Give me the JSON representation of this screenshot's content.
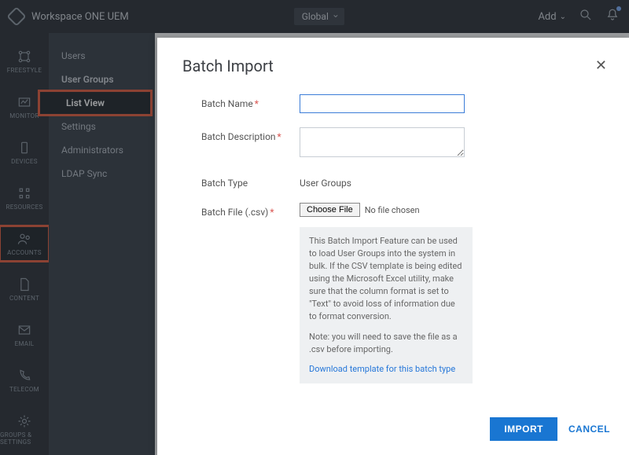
{
  "header": {
    "product": "Workspace ONE UEM",
    "org_selector": "Global",
    "add_label": "Add"
  },
  "leftrail": [
    {
      "id": "freestyle",
      "label": "FREESTYLE"
    },
    {
      "id": "monitor",
      "label": "MONITOR"
    },
    {
      "id": "devices",
      "label": "DEVICES"
    },
    {
      "id": "resources",
      "label": "RESOURCES"
    },
    {
      "id": "accounts",
      "label": "ACCOUNTS"
    },
    {
      "id": "content",
      "label": "CONTENT"
    },
    {
      "id": "email",
      "label": "EMAIL"
    },
    {
      "id": "telecom",
      "label": "TELECOM"
    },
    {
      "id": "groups",
      "label": "GROUPS & SETTINGS"
    }
  ],
  "subnav": {
    "items": [
      {
        "label": "Users"
      },
      {
        "label": "User Groups"
      },
      {
        "label": "List View"
      },
      {
        "label": "Settings"
      },
      {
        "label": "Administrators"
      },
      {
        "label": "LDAP Sync"
      }
    ]
  },
  "modal": {
    "title": "Batch Import",
    "fields": {
      "name_label": "Batch Name",
      "desc_label": "Batch Description",
      "type_label": "Batch Type",
      "type_value": "User Groups",
      "file_label": "Batch File (.csv)",
      "choose_label": "Choose File",
      "no_file": "No file chosen"
    },
    "info": {
      "p1": "This Batch Import Feature can be used to load User Groups into the system in bulk. If the CSV template is being edited using the Microsoft Excel utility, make sure that the column format is set to \"Text\" to avoid loss of information due to format conversion.",
      "p2": "Note: you will need to save the file as a .csv before importing.",
      "link": "Download template for this batch type"
    },
    "actions": {
      "import": "IMPORT",
      "cancel": "CANCEL"
    }
  }
}
